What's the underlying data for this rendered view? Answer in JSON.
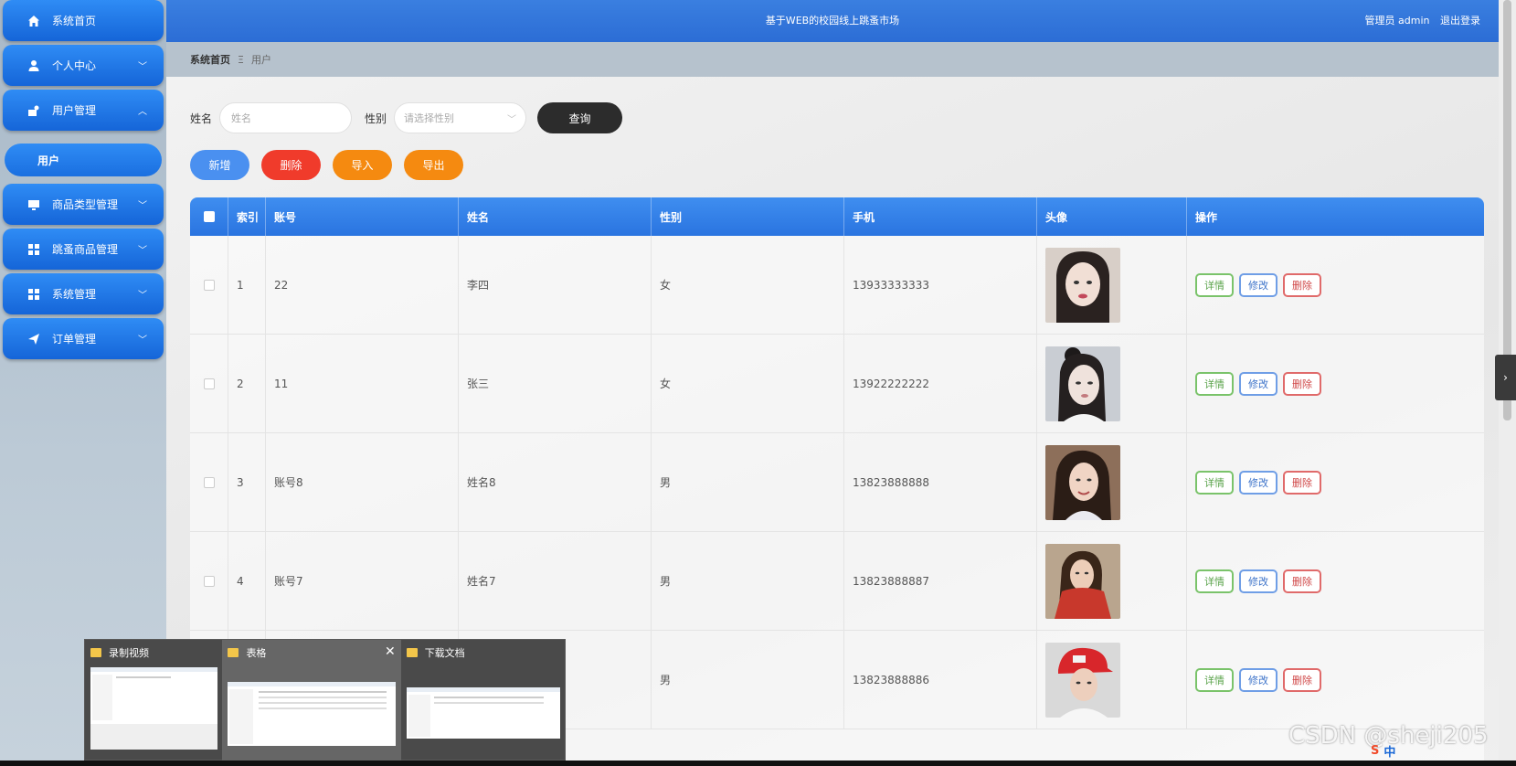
{
  "sidebar": {
    "items": [
      {
        "label": "系统首页",
        "icon": "home-icon",
        "expanded": null
      },
      {
        "label": "个人中心",
        "icon": "person-icon",
        "expanded": false
      },
      {
        "label": "用户管理",
        "icon": "user-manage-icon",
        "expanded": true
      },
      {
        "label": "商品类型管理",
        "icon": "monitor-icon",
        "expanded": false
      },
      {
        "label": "跳蚤商品管理",
        "icon": "grid-icon",
        "expanded": false
      },
      {
        "label": "系统管理",
        "icon": "grid-icon",
        "expanded": false
      },
      {
        "label": "订单管理",
        "icon": "send-icon",
        "expanded": false
      }
    ],
    "sub_item": "用户"
  },
  "header": {
    "title": "基于WEB的校园线上跳蚤市场",
    "user": "管理员 admin",
    "logout": "退出登录"
  },
  "breadcrumb": {
    "home": "系统首页",
    "separator": "Ξ",
    "current": "用户"
  },
  "search": {
    "name_label": "姓名",
    "name_placeholder": "姓名",
    "gender_label": "性别",
    "gender_placeholder": "请选择性别",
    "query": "查询"
  },
  "actions": {
    "add": "新增",
    "delete": "删除",
    "import": "导入",
    "export": "导出"
  },
  "colors": {
    "add": "#4a90f0",
    "delete": "#f03b2b",
    "import": "#f58a10",
    "export": "#f58a10"
  },
  "table": {
    "headers": [
      "索引",
      "账号",
      "姓名",
      "性别",
      "手机",
      "头像",
      "操作"
    ],
    "rows": [
      {
        "index": "1",
        "account": "22",
        "name": "李四",
        "gender": "女",
        "phone": "13933333333"
      },
      {
        "index": "2",
        "account": "11",
        "name": "张三",
        "gender": "女",
        "phone": "13922222222"
      },
      {
        "index": "3",
        "account": "账号8",
        "name": "姓名8",
        "gender": "男",
        "phone": "13823888888"
      },
      {
        "index": "4",
        "account": "账号7",
        "name": "姓名7",
        "gender": "男",
        "phone": "13823888887"
      },
      {
        "index": "",
        "account": "",
        "name": "",
        "gender": "男",
        "phone": "13823888886"
      }
    ],
    "ops": {
      "detail": "详情",
      "edit": "修改",
      "delete": "删除"
    }
  },
  "taskbar_preview": {
    "windows": [
      "录制视频",
      "表格",
      "下载文档"
    ]
  },
  "watermark": "CSDN @sheji205",
  "ime": {
    "lang": "中"
  }
}
